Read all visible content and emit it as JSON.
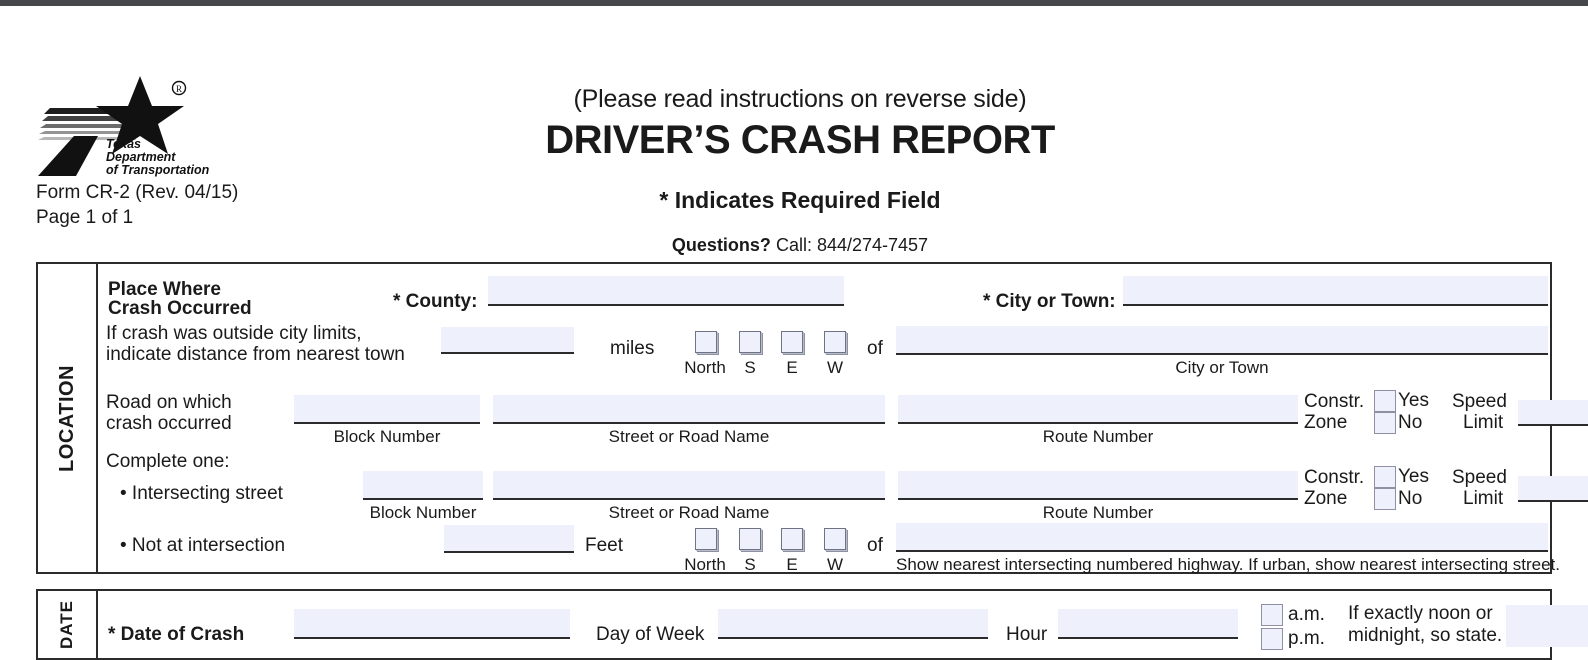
{
  "document": {
    "agency_logo_alt": "Texas Department of Transportation",
    "logo_lines": [
      "Texas",
      "Department",
      "of Transportation"
    ],
    "form_id": "Form CR-2 (Rev. 04/15)",
    "page_number": "Page 1 of 1",
    "instructions_note": "(Please read instructions on reverse side)",
    "title": "DRIVER’S CRASH REPORT",
    "required_field_note": "* Indicates Required Field",
    "questions_label": "Questions?",
    "questions_text": " Call: 844/274-7457"
  },
  "location": {
    "section_label": "LOCATION",
    "place_heading_line1": "Place Where",
    "place_heading_line2": "Crash Occurred",
    "county_label": "* County:",
    "county_value": "",
    "city_or_town_label": "* City or Town:",
    "city_or_town_value": "",
    "outside_limits_line1": "If crash was outside city limits,",
    "outside_limits_line2": "indicate distance from nearest town",
    "distance_value": "",
    "miles_label": "miles",
    "directions": [
      "North",
      "S",
      "E",
      "W"
    ],
    "of_label": "of",
    "nearest_town_value": "",
    "nearest_town_caption": "City or Town",
    "road_line1": "Road on which",
    "road_line2": "crash occurred",
    "road_block_number": "",
    "road_block_caption": "Block Number",
    "road_street_name": "",
    "road_street_caption": "Street or Road Name",
    "road_route_number": "",
    "road_route_caption": "Route Number",
    "constr_zone_line1": "Constr.",
    "constr_zone_line2": "Zone",
    "yes_label": "Yes",
    "no_label": "No",
    "speed_line1": "Speed",
    "speed_line2": "Limit",
    "road_speed_limit": "",
    "complete_one_label": "Complete one:",
    "intersecting_street_label": "• Intersecting street",
    "int_block_number": "",
    "int_block_caption": "Block Number",
    "int_street_name": "",
    "int_street_caption": "Street or Road Name",
    "int_route_number": "",
    "int_route_caption": "Route Number",
    "int_speed_limit": "",
    "not_at_intersection_label": "• Not at intersection",
    "feet_value": "",
    "feet_label": "Feet",
    "not_at_int_of_label": "of",
    "nearest_highway_value": "",
    "nearest_highway_caption": "Show nearest intersecting numbered highway.  If urban, show nearest intersecting street."
  },
  "date": {
    "section_label": "DATE",
    "date_of_crash_label": "* Date of Crash",
    "date_of_crash_value": "",
    "day_of_week_label": "Day of Week",
    "day_of_week_value": "",
    "hour_label": "Hour",
    "hour_value": "",
    "am_label": "a.m.",
    "pm_label": "p.m.",
    "noon_note_line1": "If exactly noon or",
    "noon_note_line2": "midnight, so state.",
    "noon_note_value": ""
  },
  "colors": {
    "field_fill": "#eef0fb",
    "rule": "#2b2b2b",
    "text": "#1a1a1a",
    "chrome_bar": "#45474a"
  }
}
